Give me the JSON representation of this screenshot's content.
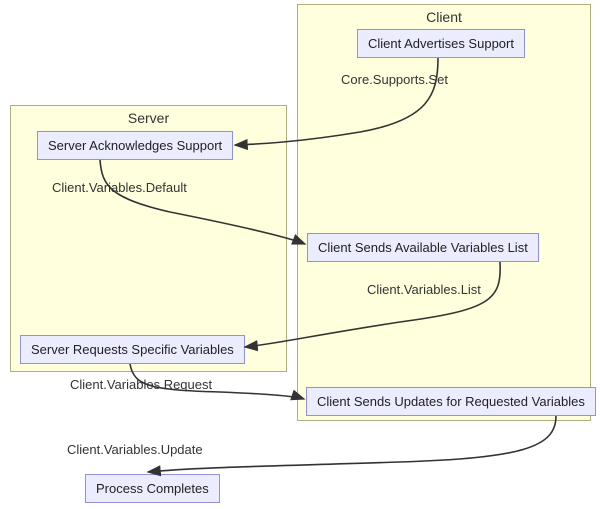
{
  "groups": {
    "client": {
      "title": "Client"
    },
    "server": {
      "title": "Server"
    }
  },
  "nodes": {
    "client_advertises": "Client Advertises Support",
    "server_ack": "Server Acknowledges Support",
    "client_sends_list": "Client Sends Available Variables List",
    "server_requests": "Server Requests Specific Variables",
    "client_sends_updates": "Client Sends Updates for Requested Variables",
    "process_completes": "Process Completes"
  },
  "edges": {
    "e1": "Core.Supports.Set",
    "e2": "Client.Variables.Default",
    "e3": "Client.Variables.List",
    "e4": "Client.Variables.Request",
    "e5": "Client.Variables.Update"
  }
}
